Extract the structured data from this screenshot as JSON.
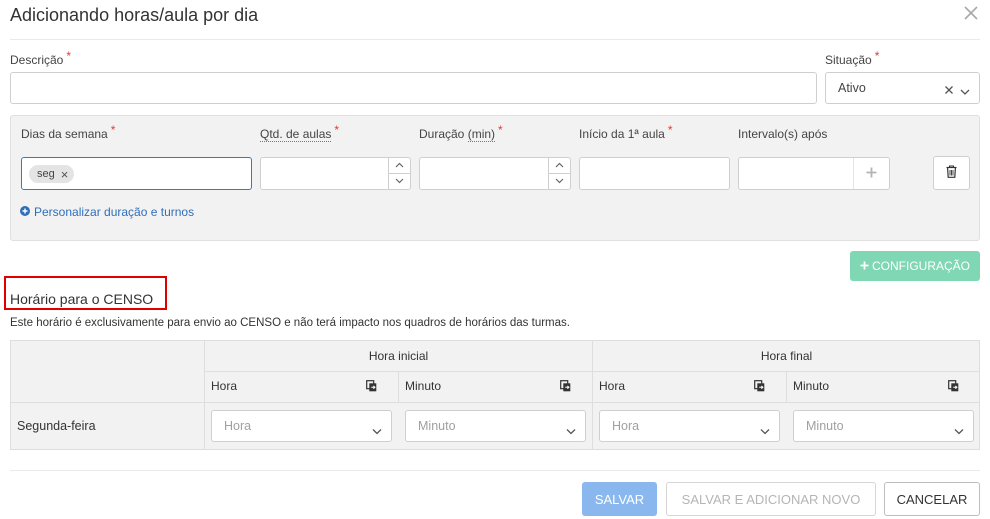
{
  "modal": {
    "title": "Adicionando horas/aula por dia",
    "close_icon": "close-icon"
  },
  "form": {
    "descricao": {
      "label": "Descrição",
      "value": ""
    },
    "situacao": {
      "label": "Situação",
      "value": "Ativo"
    },
    "required_mark": "*"
  },
  "config": {
    "dias_semana": {
      "label": "Dias da semana",
      "tags": [
        "seg"
      ]
    },
    "qtd_aulas": {
      "label": "Qtd. de aulas",
      "value": ""
    },
    "duracao": {
      "label": "Duração",
      "unit": "(min)",
      "value": ""
    },
    "inicio": {
      "label": "Início da 1ª aula",
      "value": ""
    },
    "intervalos": {
      "label": "Intervalo(s) após",
      "value": ""
    },
    "personalizar_link": "Personalizar duração e turnos",
    "add_config_button": "CONFIGURAÇÃO"
  },
  "censo": {
    "title": "Horário para o CENSO",
    "description": "Este horário é exclusivamente para envio ao CENSO e não terá impacto nos quadros de horários das turmas.",
    "group_headers": [
      "Hora inicial",
      "Hora final"
    ],
    "sub_headers": [
      "Hora",
      "Minuto",
      "Hora",
      "Minuto"
    ],
    "rows": [
      {
        "day": "Segunda-feira",
        "placeholders": [
          "Hora",
          "Minuto",
          "Hora",
          "Minuto"
        ]
      }
    ]
  },
  "footer": {
    "save": "SALVAR",
    "save_add": "SALVAR E ADICIONAR NOVO",
    "cancel": "CANCELAR"
  },
  "colors": {
    "accent_blue": "#3a78c3",
    "required_red": "#e53935",
    "config_green": "#7fd7b4",
    "save_blue": "#8ab8ee",
    "highlight_red": "#e00000"
  }
}
